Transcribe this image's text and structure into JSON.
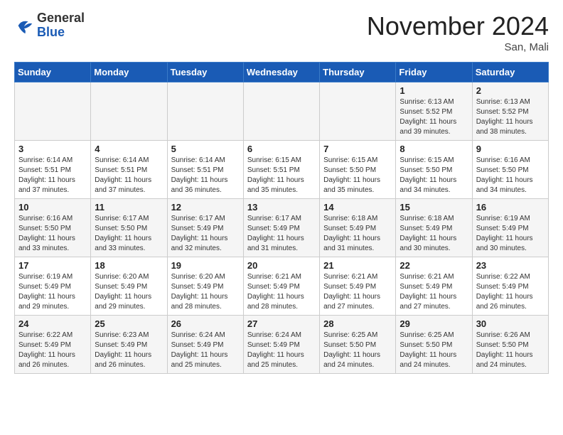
{
  "logo": {
    "general": "General",
    "blue": "Blue"
  },
  "header": {
    "title": "November 2024",
    "location": "San, Mali"
  },
  "days_of_week": [
    "Sunday",
    "Monday",
    "Tuesday",
    "Wednesday",
    "Thursday",
    "Friday",
    "Saturday"
  ],
  "weeks": [
    [
      {
        "day": "",
        "info": ""
      },
      {
        "day": "",
        "info": ""
      },
      {
        "day": "",
        "info": ""
      },
      {
        "day": "",
        "info": ""
      },
      {
        "day": "",
        "info": ""
      },
      {
        "day": "1",
        "info": "Sunrise: 6:13 AM\nSunset: 5:52 PM\nDaylight: 11 hours and 39 minutes."
      },
      {
        "day": "2",
        "info": "Sunrise: 6:13 AM\nSunset: 5:52 PM\nDaylight: 11 hours and 38 minutes."
      }
    ],
    [
      {
        "day": "3",
        "info": "Sunrise: 6:14 AM\nSunset: 5:51 PM\nDaylight: 11 hours and 37 minutes."
      },
      {
        "day": "4",
        "info": "Sunrise: 6:14 AM\nSunset: 5:51 PM\nDaylight: 11 hours and 37 minutes."
      },
      {
        "day": "5",
        "info": "Sunrise: 6:14 AM\nSunset: 5:51 PM\nDaylight: 11 hours and 36 minutes."
      },
      {
        "day": "6",
        "info": "Sunrise: 6:15 AM\nSunset: 5:51 PM\nDaylight: 11 hours and 35 minutes."
      },
      {
        "day": "7",
        "info": "Sunrise: 6:15 AM\nSunset: 5:50 PM\nDaylight: 11 hours and 35 minutes."
      },
      {
        "day": "8",
        "info": "Sunrise: 6:15 AM\nSunset: 5:50 PM\nDaylight: 11 hours and 34 minutes."
      },
      {
        "day": "9",
        "info": "Sunrise: 6:16 AM\nSunset: 5:50 PM\nDaylight: 11 hours and 34 minutes."
      }
    ],
    [
      {
        "day": "10",
        "info": "Sunrise: 6:16 AM\nSunset: 5:50 PM\nDaylight: 11 hours and 33 minutes."
      },
      {
        "day": "11",
        "info": "Sunrise: 6:17 AM\nSunset: 5:50 PM\nDaylight: 11 hours and 33 minutes."
      },
      {
        "day": "12",
        "info": "Sunrise: 6:17 AM\nSunset: 5:49 PM\nDaylight: 11 hours and 32 minutes."
      },
      {
        "day": "13",
        "info": "Sunrise: 6:17 AM\nSunset: 5:49 PM\nDaylight: 11 hours and 31 minutes."
      },
      {
        "day": "14",
        "info": "Sunrise: 6:18 AM\nSunset: 5:49 PM\nDaylight: 11 hours and 31 minutes."
      },
      {
        "day": "15",
        "info": "Sunrise: 6:18 AM\nSunset: 5:49 PM\nDaylight: 11 hours and 30 minutes."
      },
      {
        "day": "16",
        "info": "Sunrise: 6:19 AM\nSunset: 5:49 PM\nDaylight: 11 hours and 30 minutes."
      }
    ],
    [
      {
        "day": "17",
        "info": "Sunrise: 6:19 AM\nSunset: 5:49 PM\nDaylight: 11 hours and 29 minutes."
      },
      {
        "day": "18",
        "info": "Sunrise: 6:20 AM\nSunset: 5:49 PM\nDaylight: 11 hours and 29 minutes."
      },
      {
        "day": "19",
        "info": "Sunrise: 6:20 AM\nSunset: 5:49 PM\nDaylight: 11 hours and 28 minutes."
      },
      {
        "day": "20",
        "info": "Sunrise: 6:21 AM\nSunset: 5:49 PM\nDaylight: 11 hours and 28 minutes."
      },
      {
        "day": "21",
        "info": "Sunrise: 6:21 AM\nSunset: 5:49 PM\nDaylight: 11 hours and 27 minutes."
      },
      {
        "day": "22",
        "info": "Sunrise: 6:21 AM\nSunset: 5:49 PM\nDaylight: 11 hours and 27 minutes."
      },
      {
        "day": "23",
        "info": "Sunrise: 6:22 AM\nSunset: 5:49 PM\nDaylight: 11 hours and 26 minutes."
      }
    ],
    [
      {
        "day": "24",
        "info": "Sunrise: 6:22 AM\nSunset: 5:49 PM\nDaylight: 11 hours and 26 minutes."
      },
      {
        "day": "25",
        "info": "Sunrise: 6:23 AM\nSunset: 5:49 PM\nDaylight: 11 hours and 26 minutes."
      },
      {
        "day": "26",
        "info": "Sunrise: 6:24 AM\nSunset: 5:49 PM\nDaylight: 11 hours and 25 minutes."
      },
      {
        "day": "27",
        "info": "Sunrise: 6:24 AM\nSunset: 5:49 PM\nDaylight: 11 hours and 25 minutes."
      },
      {
        "day": "28",
        "info": "Sunrise: 6:25 AM\nSunset: 5:50 PM\nDaylight: 11 hours and 24 minutes."
      },
      {
        "day": "29",
        "info": "Sunrise: 6:25 AM\nSunset: 5:50 PM\nDaylight: 11 hours and 24 minutes."
      },
      {
        "day": "30",
        "info": "Sunrise: 6:26 AM\nSunset: 5:50 PM\nDaylight: 11 hours and 24 minutes."
      }
    ]
  ]
}
